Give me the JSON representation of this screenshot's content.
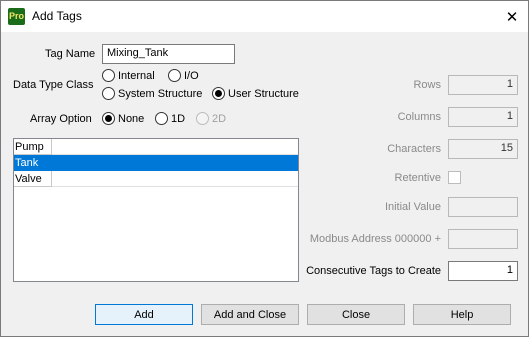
{
  "window": {
    "title": "Add Tags",
    "icon_text": "Pro"
  },
  "tag_name": {
    "label": "Tag Name",
    "value": "Mixing_Tank"
  },
  "data_type_class": {
    "label": "Data Type Class",
    "options": [
      "Internal",
      "I/O",
      "System Structure",
      "User Structure"
    ],
    "selected": "User Structure"
  },
  "array_option": {
    "label": "Array Option",
    "options": [
      "None",
      "1D",
      "2D"
    ],
    "selected": "None"
  },
  "structure_list": {
    "items": [
      "Pump",
      "Tank",
      "Valve"
    ],
    "selected": "Tank"
  },
  "right_panel": {
    "rows": {
      "label": "Rows",
      "value": "1"
    },
    "columns": {
      "label": "Columns",
      "value": "1"
    },
    "characters": {
      "label": "Characters",
      "value": "15"
    },
    "retentive": {
      "label": "Retentive",
      "checked": false
    },
    "initial_value": {
      "label": "Initial Value",
      "value": ""
    },
    "modbus_address": {
      "label": "Modbus Address 000000 +",
      "value": ""
    },
    "consecutive": {
      "label": "Consecutive Tags to Create",
      "value": "1"
    }
  },
  "buttons": {
    "add": "Add",
    "add_close": "Add and Close",
    "close": "Close",
    "help": "Help"
  }
}
